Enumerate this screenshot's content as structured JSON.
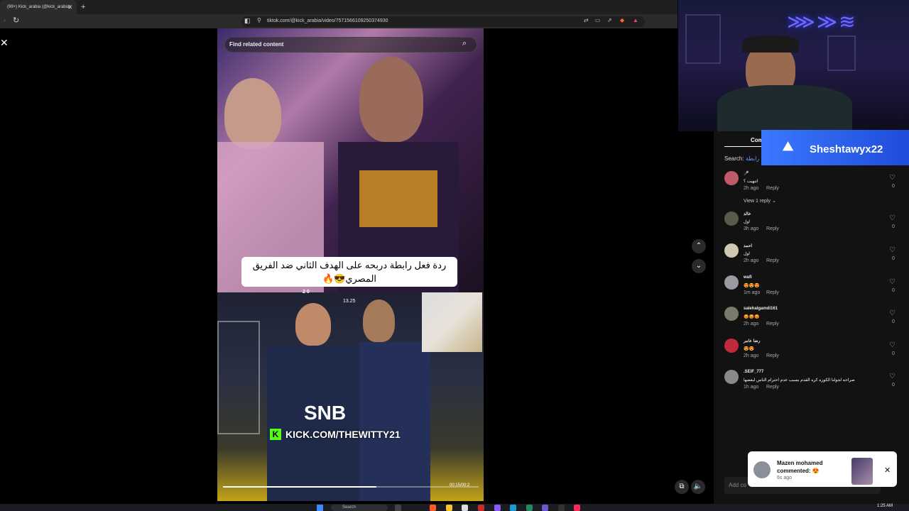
{
  "browser": {
    "tab_title": "(99+) Kick_arabia (@kick_arabia)",
    "new_tab": "+",
    "url": "tiktok.com/@kick_arabia/video/7571566109250374930"
  },
  "video": {
    "search_placeholder": "Find related content",
    "caption": "ردة فعل رابطة دربحه على الهدف الثاني ضد الفريق المصري😎🔥",
    "score": "2  0",
    "timer": "13.25",
    "kick_url": "KICK.COM/THEWITTY21",
    "sponsor": "SNB",
    "time_display": "00:15/00:2",
    "progress": 0.6
  },
  "comments_panel": {
    "tab": "Com",
    "search_label": "Search:",
    "search_term": "رابطة",
    "view_reply": "View 1 reply ⌄",
    "add_comment": "Add co",
    "items": [
      {
        "user": "🎤",
        "text": "انتهيت ؟",
        "time": "2h ago",
        "reply": "Reply",
        "likes": "0"
      },
      {
        "user": "خالد",
        "text": "اول",
        "time": "3h ago",
        "reply": "Reply",
        "likes": "0"
      },
      {
        "user": "احمد",
        "text": "اول",
        "time": "2h ago",
        "reply": "Reply",
        "likes": "0"
      },
      {
        "user": "wafi",
        "text": "😍😍😍",
        "time": "1m ago",
        "reply": "Reply",
        "likes": "0"
      },
      {
        "user": "salehalgamdi161",
        "text": "😡😡😡",
        "time": "2h ago",
        "reply": "Reply",
        "likes": "0"
      },
      {
        "user": "رضا عامر",
        "text": "😍😍",
        "time": "2h ago",
        "reply": "Reply",
        "likes": "0"
      },
      {
        "user": ".SEIF_777",
        "text": "صراحه لجولنا الكوره كره القدم بسبب عدم احترام الناس لبعضها",
        "time": "1h ago",
        "reply": "Reply",
        "likes": "0"
      }
    ]
  },
  "overlay": {
    "ps_name": "Sheshtawyx22",
    "neon": "⋙≫≋"
  },
  "notification": {
    "name": "Mazen mohamed",
    "message": "commented: 😍",
    "time": "6s ago"
  },
  "taskbar": {
    "search": "Search",
    "clock": "1:25 AM"
  },
  "icons": {
    "close": "✕",
    "search": "⌕",
    "heart": "♡",
    "up": "⌃",
    "down": "⌄"
  }
}
